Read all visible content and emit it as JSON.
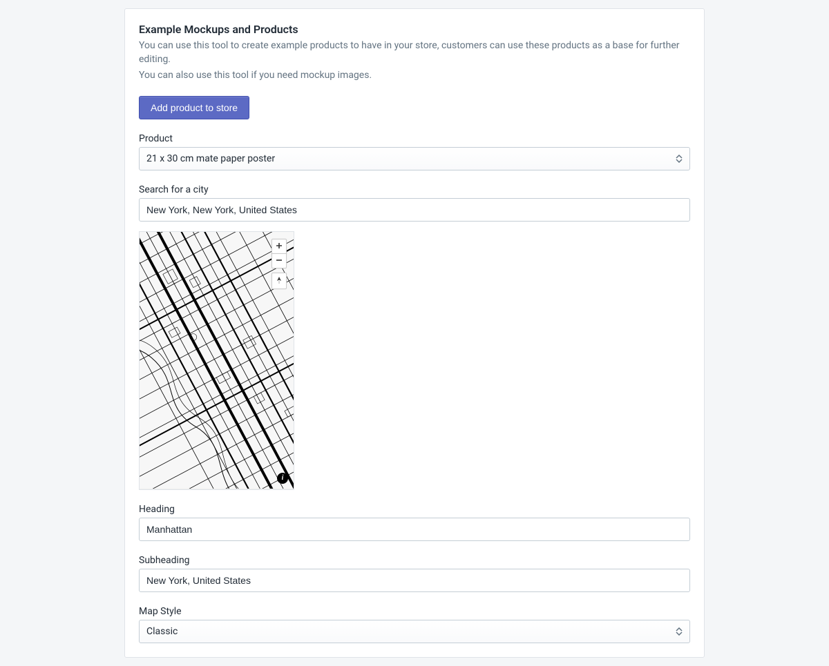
{
  "header": {
    "title": "Example Mockups and Products",
    "desc_line1": "You can use this tool to create example products to have in your store, customers can use these products as a base for further editing.",
    "desc_line2": "You can also use this tool if you need mockup images."
  },
  "actions": {
    "add_product_label": "Add product to store"
  },
  "fields": {
    "product": {
      "label": "Product",
      "value": "21 x 30 cm mate paper poster"
    },
    "search": {
      "label": "Search for a city",
      "value": "New York, New York, United States"
    },
    "heading": {
      "label": "Heading",
      "value": "Manhattan"
    },
    "subheading": {
      "label": "Subheading",
      "value": "New York, United States"
    },
    "map_style": {
      "label": "Map Style",
      "value": "Classic"
    }
  },
  "map": {
    "info_glyph": "i"
  }
}
